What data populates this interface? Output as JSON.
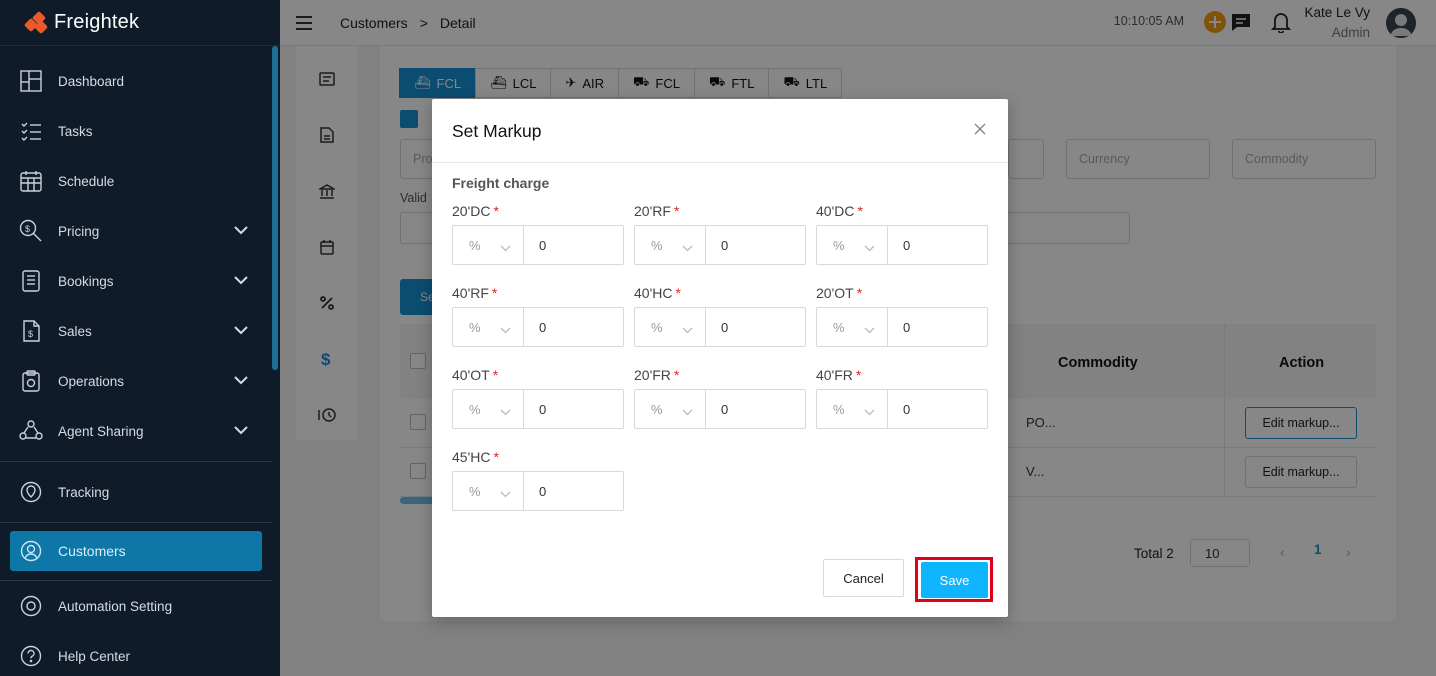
{
  "app": {
    "name": "Freightek"
  },
  "sidebar": {
    "items": [
      {
        "label": "Dashboard"
      },
      {
        "label": "Tasks"
      },
      {
        "label": "Schedule"
      },
      {
        "label": "Pricing"
      },
      {
        "label": "Bookings"
      },
      {
        "label": "Sales"
      },
      {
        "label": "Operations"
      },
      {
        "label": "Agent Sharing"
      },
      {
        "label": "Tracking"
      },
      {
        "label": "Customers"
      },
      {
        "label": "Automation Setting"
      },
      {
        "label": "Help Center"
      }
    ]
  },
  "topbar": {
    "breadcrumb": [
      "Customers",
      ">",
      "Detail"
    ],
    "clock": "10:10:05 AM",
    "user_name": "Kate Le Vy",
    "user_role": "Admin"
  },
  "background": {
    "mode_tabs": [
      "FCL",
      "LCL",
      "AIR",
      "FCL",
      "FTL",
      "LTL"
    ],
    "filters": {
      "field1": "Pro",
      "currency": "Currency",
      "commodity": "Commodity"
    },
    "valid_label": "Valid",
    "search_button": "Se",
    "table": {
      "headers": [
        "Commodity",
        "Action"
      ],
      "rows": [
        {
          "commodity": "PO...",
          "action": "Edit markup..."
        },
        {
          "commodity": "V...",
          "action": "Edit markup..."
        }
      ]
    },
    "pagination": {
      "total": "Total 2",
      "page_size": "10",
      "current_page": "1"
    }
  },
  "modal": {
    "title": "Set Markup",
    "section_title": "Freight charge",
    "fields": [
      {
        "label": "20'DC",
        "unit": "%",
        "value": "0"
      },
      {
        "label": "20'RF",
        "unit": "%",
        "value": "0"
      },
      {
        "label": "40'DC",
        "unit": "%",
        "value": "0"
      },
      {
        "label": "40'RF",
        "unit": "%",
        "value": "0"
      },
      {
        "label": "40'HC",
        "unit": "%",
        "value": "0"
      },
      {
        "label": "20'OT",
        "unit": "%",
        "value": "0"
      },
      {
        "label": "40'OT",
        "unit": "%",
        "value": "0"
      },
      {
        "label": "20'FR",
        "unit": "%",
        "value": "0"
      },
      {
        "label": "40'FR",
        "unit": "%",
        "value": "0"
      },
      {
        "label": "45'HC",
        "unit": "%",
        "value": "0"
      }
    ],
    "required_mark": "*",
    "cancel_label": "Cancel",
    "save_label": "Save"
  },
  "colors": {
    "sidebar_bg": "#101b29",
    "accent": "#1592d6",
    "save_button": "#10b5ff",
    "highlight": "#e1001b",
    "brand": "#ea5a2b"
  }
}
